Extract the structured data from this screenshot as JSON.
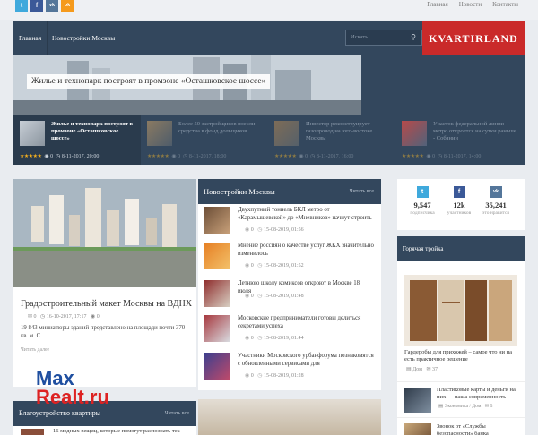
{
  "topbar": {
    "social": [
      {
        "icon": "twitter-icon",
        "glyph": "t",
        "color": "#3fa9dc"
      },
      {
        "icon": "facebook-icon",
        "glyph": "f",
        "color": "#3b5998"
      },
      {
        "icon": "vk-icon",
        "glyph": "vk",
        "color": "#54769a"
      },
      {
        "icon": "odnoklassniki-icon",
        "glyph": "ok",
        "color": "#f59a1c"
      }
    ],
    "links": [
      "Главная",
      "Новости",
      "Контакты"
    ]
  },
  "nav": {
    "items": [
      "Главная",
      "Новостройки Москвы"
    ],
    "search_placeholder": "Искать...",
    "search_icon": "search-icon",
    "logo": "KVARTIRLAND"
  },
  "hero": {
    "title": "Жилье и технопарк построят в промзоне «Осташковское шоссе»"
  },
  "slider": [
    {
      "title": "Жилье и технопарк построят в промзоне «Осташковское шоссе»",
      "comments": "0",
      "date": "8-11-2017, 20:00"
    },
    {
      "title": "Более 50 застройщиков внесли средства в фонд дольщиков",
      "comments": "0",
      "date": "8-11-2017, 18:00"
    },
    {
      "title": "Инвестор реконструирует газопровод на юго-востоке Москвы",
      "comments": "0",
      "date": "8-11-2017, 16:00"
    },
    {
      "title": "Участок федеральной линии метро откроется на сутки раньше - Собянин",
      "comments": "0",
      "date": "8-11-2017, 14:00"
    }
  ],
  "featured": {
    "title": "Градостроительный макет Москвы на ВДНХ",
    "comments": "0",
    "date": "16-10-2017, 17:17",
    "views": "0",
    "text": "19 843 миниатюры зданий представлено на площади почти 370 кв. м. С",
    "more": "Читать далее"
  },
  "news_block": {
    "title": "Новостройки Москвы",
    "more": "Читать все",
    "items": [
      {
        "title": "Двухпутный тоннель БКЛ метро от «Карамышевской» до «Мневников» начнут строить",
        "views": "0",
        "date": "15-08-2019, 01:56"
      },
      {
        "title": "Мнение россиян о качестве услуг ЖКХ значительно изменилось",
        "views": "0",
        "date": "15-08-2019, 01:52"
      },
      {
        "title": "Летнюю школу комиксов откроют в Москве 18 июля",
        "views": "0",
        "date": "15-08-2019, 01:48"
      },
      {
        "title": "Московские предприниматели готовы делиться секретами успеха",
        "views": "0",
        "date": "15-08-2019, 01:44"
      },
      {
        "title": "Участники Московского урбанфорума познакомятся с обновленными сервисами для",
        "views": "0",
        "date": "15-08-2019, 01:28"
      }
    ]
  },
  "sidebar": {
    "social_stats": [
      {
        "icon": "twitter-icon",
        "glyph": "t",
        "color": "#3fa9dc",
        "count": "9,547",
        "label": "подписчика"
      },
      {
        "icon": "facebook-icon",
        "glyph": "f",
        "color": "#3b5998",
        "count": "12k",
        "label": "участников"
      },
      {
        "icon": "vk-icon",
        "glyph": "vk",
        "color": "#54769a",
        "count": "35,241",
        "label": "это нравится"
      }
    ],
    "hot_title": "Горячая тройка",
    "hot_main": {
      "title": "Гардеробы для прихожей – самое что ни на есть практичное решение",
      "category": "Дом",
      "comments": "37"
    },
    "hot_items": [
      {
        "title": "Пластиковые карты и деньги на них — наша современность",
        "category": "Экономика / Дом",
        "comments": "5"
      },
      {
        "title": "Звонок от «Службы безопасности» банка",
        "category": "",
        "comments": ""
      }
    ]
  },
  "bottom_block": {
    "title": "Благоустройство квартиры",
    "more": "Читать все",
    "first_item": "16 модных вещиц, которые помогут распознать тех"
  },
  "watermark": {
    "line1": "Max",
    "line2": "Realt.ru"
  }
}
